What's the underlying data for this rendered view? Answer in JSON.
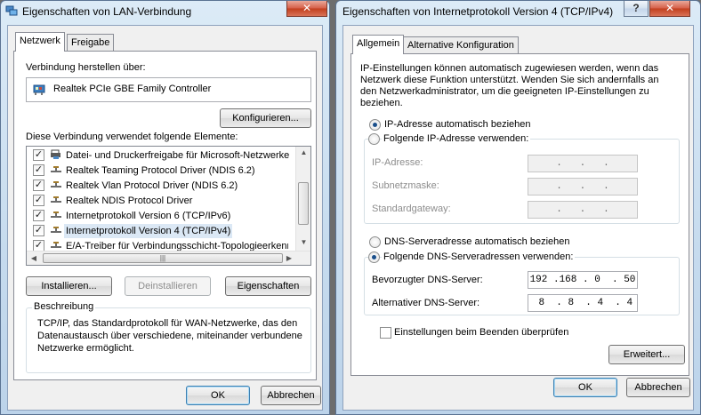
{
  "left_dialog": {
    "title": "Eigenschaften von LAN-Verbindung",
    "close_glyph": "✕",
    "tabs": [
      {
        "label": "Netzwerk",
        "active": true
      },
      {
        "label": "Freigabe",
        "active": false
      }
    ],
    "connect_using_label": "Verbindung herstellen über:",
    "adapter_name": "Realtek PCIe GBE Family Controller",
    "configure_button": "Konfigurieren...",
    "components_label": "Diese Verbindung verwendet folgende Elemente:",
    "components": [
      {
        "label": "Datei- und Druckerfreigabe für Microsoft-Netzwerke",
        "checked": true,
        "icon": "printer-share-icon"
      },
      {
        "label": "Realtek Teaming Protocol Driver (NDIS 6.2)",
        "checked": true,
        "icon": "protocol-icon"
      },
      {
        "label": "Realtek Vlan Protocol Driver (NDIS 6.2)",
        "checked": true,
        "icon": "protocol-icon"
      },
      {
        "label": "Realtek NDIS Protocol Driver",
        "checked": true,
        "icon": "protocol-icon"
      },
      {
        "label": "Internetprotokoll Version 6 (TCP/IPv6)",
        "checked": true,
        "icon": "protocol-icon"
      },
      {
        "label": "Internetprotokoll Version 4 (TCP/IPv4)",
        "checked": true,
        "icon": "protocol-icon",
        "selected": true
      },
      {
        "label": "E/A-Treiber für Verbindungsschicht-Topologieerkennung",
        "checked": true,
        "icon": "protocol-icon"
      }
    ],
    "hscroll_thumb_glyph": "|||",
    "install_button": "Installieren...",
    "uninstall_button": "Deinstallieren",
    "properties_button": "Eigenschaften",
    "description_label": "Beschreibung",
    "description_text": "TCP/IP, das Standardprotokoll für WAN-Netzwerke, das den Datenaustausch über verschiedene, miteinander verbundene Netzwerke ermöglicht.",
    "ok_button": "OK",
    "cancel_button": "Abbrechen"
  },
  "right_dialog": {
    "title": "Eigenschaften von Internetprotokoll Version 4 (TCP/IPv4)",
    "help_glyph": "?",
    "close_glyph": "✕",
    "tabs": [
      {
        "label": "Allgemein",
        "active": true
      },
      {
        "label": "Alternative Konfiguration",
        "active": false
      }
    ],
    "intro_text": "IP-Einstellungen können automatisch zugewiesen werden, wenn das Netzwerk diese Funktion unterstützt. Wenden Sie sich andernfalls an den Netzwerkadministrator, um die geeigneten IP-Einstellungen zu beziehen.",
    "ip_auto_label": "IP-Adresse automatisch beziehen",
    "ip_auto_selected": true,
    "ip_manual_label": "Folgende IP-Adresse verwenden:",
    "ip_manual_selected": false,
    "ip_address_label": "IP-Adresse:",
    "subnet_label": "Subnetzmaske:",
    "gateway_label": "Standardgateway:",
    "ip_address_value": "  .   .   .  ",
    "subnet_value": "  .   .   .  ",
    "gateway_value": "  .   .   .  ",
    "dns_auto_label": "DNS-Serveradresse automatisch beziehen",
    "dns_auto_selected": false,
    "dns_manual_label": "Folgende DNS-Serveradressen verwenden:",
    "dns_manual_selected": true,
    "preferred_dns_label": "Bevorzugter DNS-Server:",
    "preferred_dns_value": "192 .168 . 0  . 50",
    "alternate_dns_label": "Alternativer DNS-Server:",
    "alternate_dns_value": " 8  . 8  . 4  . 4",
    "validate_label": "Einstellungen beim Beenden überprüfen",
    "validate_checked": false,
    "advanced_button": "Erweitert...",
    "ok_button": "OK",
    "cancel_button": "Abbrechen"
  }
}
